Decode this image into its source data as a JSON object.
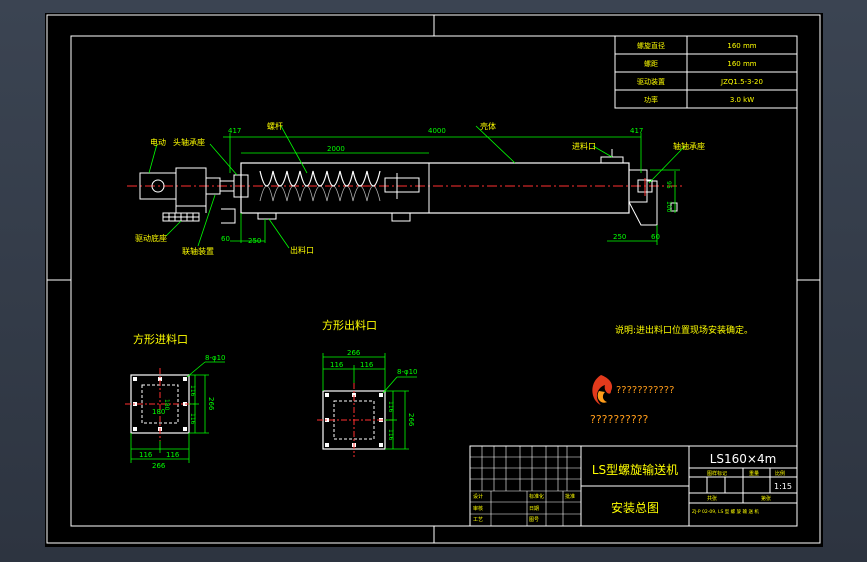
{
  "spec_table": {
    "rows": [
      {
        "label": "螺旋直径",
        "value": "160 mm"
      },
      {
        "label": "螺距",
        "value": "160 mm"
      },
      {
        "label": "驱动装置",
        "value": "JZQ1.5-3-20"
      },
      {
        "label": "功率",
        "value": "3.0 kW"
      }
    ]
  },
  "main_view": {
    "labels": {
      "motor": "电动",
      "bearing_seat": "头轴承座",
      "screw": "螺杆",
      "housing": "壳体",
      "inlet": "进料口",
      "tail_bearing": "轴轴承座",
      "drive_base": "驱动底座",
      "coupling": "联轴装置",
      "outlet": "出料口"
    },
    "dims": {
      "total_len": "4000",
      "screw_len": "2000",
      "left_off": "417",
      "right_off": "417",
      "left_bottom_a": "60",
      "left_bottom_b": "250",
      "right_bottom_a": "250",
      "right_bottom_b": "60",
      "right_h1": "95",
      "right_h2": "100"
    }
  },
  "note": "说明:进出料口位置现场安装确定。",
  "logo_text": {
    "line1": "???????????",
    "line2": "??????????"
  },
  "inlet_view": {
    "title": "方形进料口",
    "bolt": "8-φ10",
    "w_a": "116",
    "w_b": "116",
    "w_total": "266",
    "h_a": "116",
    "h_b": "116",
    "h_total": "266",
    "inner": "180",
    "inner_v": "180"
  },
  "outlet_view": {
    "title": "方形出料口",
    "bolt": "8-φ10",
    "top_total": "266",
    "top_a": "116",
    "top_b": "116",
    "h_a": "116",
    "h_b": "116",
    "h_total": "266",
    "inner": "180"
  },
  "title_block": {
    "model": "LS160×4m",
    "name": "LS型螺旋输送机",
    "drawing_name": "安装总图",
    "scale": "1:15",
    "sign_labels": [
      "设计",
      "审核",
      "工艺",
      "批准"
    ],
    "mid_labels": [
      "标准化",
      "日期",
      "图号"
    ],
    "meta_labels": [
      "图样标记",
      "重量",
      "比例"
    ],
    "page_labels": [
      "共张",
      "第张"
    ],
    "footer": "ZJ-P 02-09, LS 型 螺 旋 输 送 机"
  },
  "colors": {
    "frame": "#ffffff",
    "dimension": "#00ff00",
    "text": "#ffff00",
    "centerline": "#ff3030",
    "part": "#ffffff"
  }
}
